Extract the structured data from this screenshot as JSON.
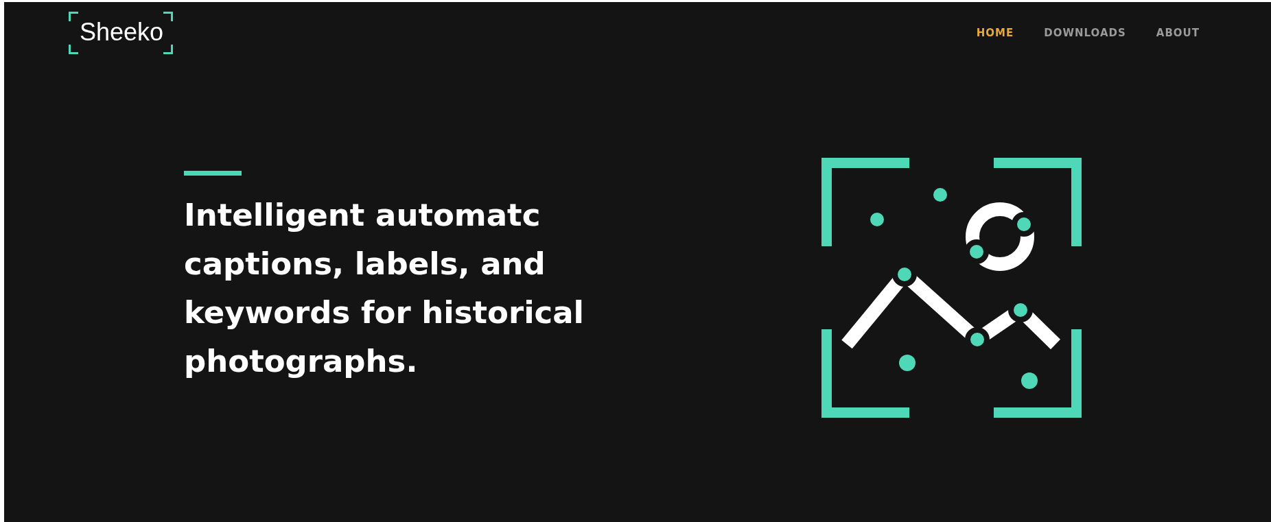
{
  "logo": {
    "text": "Sheeko"
  },
  "nav": [
    {
      "label": "HOME",
      "selected": true
    },
    {
      "label": "DOWNLOADS",
      "selected": false
    },
    {
      "label": "ABOUT",
      "selected": false
    }
  ],
  "hero": {
    "heading": "Intelligent automatc captions, labels, and keywords for historical photographs."
  }
}
